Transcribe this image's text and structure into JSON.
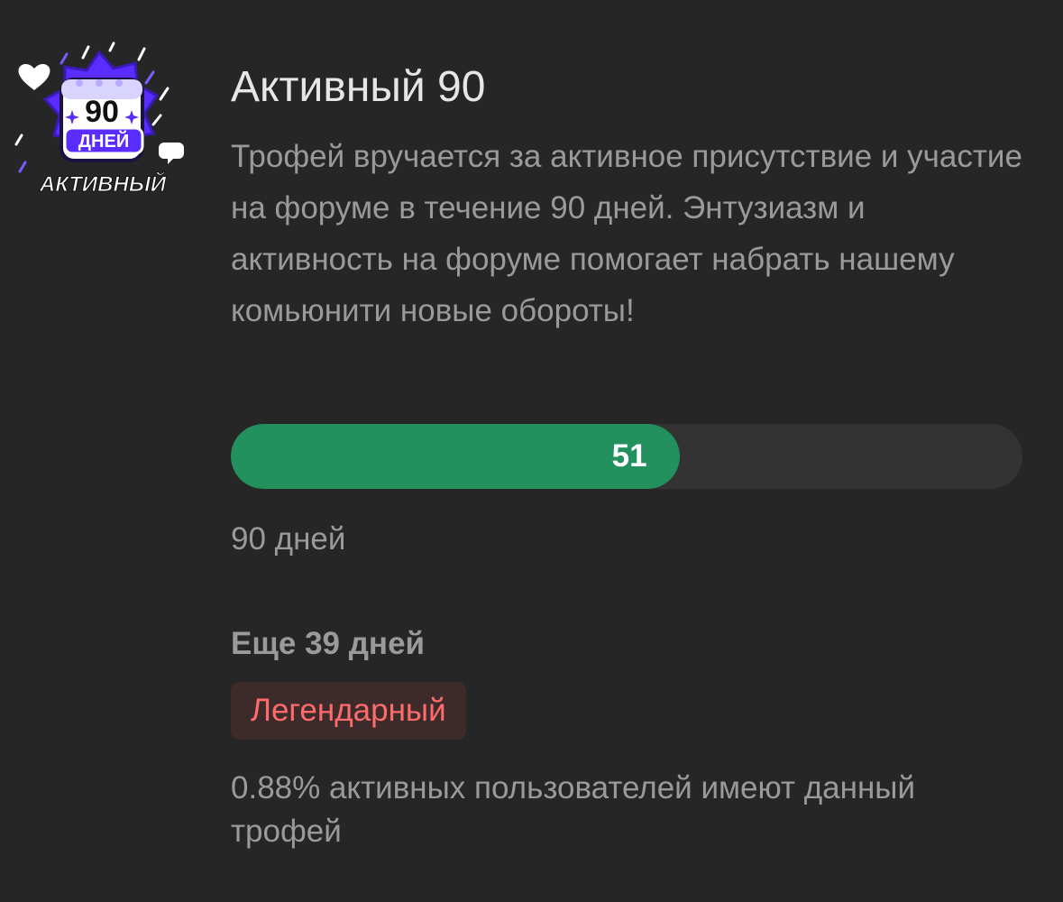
{
  "badge": {
    "number": "90",
    "days_label": "ДНЕЙ",
    "name_label": "АКТИВНЫЙ",
    "accent": "#5b2cff",
    "glow": "#7c5cff"
  },
  "trophy": {
    "title": "Активный 90",
    "description": "Трофей вручается за активное присутствие и участие на форуме в течение 90 дней. Энтузиазм и активность на форуме помогает набрать нашему комьюнити новые обороты!"
  },
  "progress": {
    "current_label": "51",
    "current": 51,
    "max": 90,
    "fill_color": "#22915e",
    "track_color": "#333333"
  },
  "goal_label": "90 дней",
  "remaining_label": "Еще 39 дней",
  "rarity": {
    "label": "Легендарный",
    "text_color": "#ff6b6b",
    "bg_color": "#3d2b2b"
  },
  "stat_label": "0.88% активных пользователей имеют данный трофей"
}
